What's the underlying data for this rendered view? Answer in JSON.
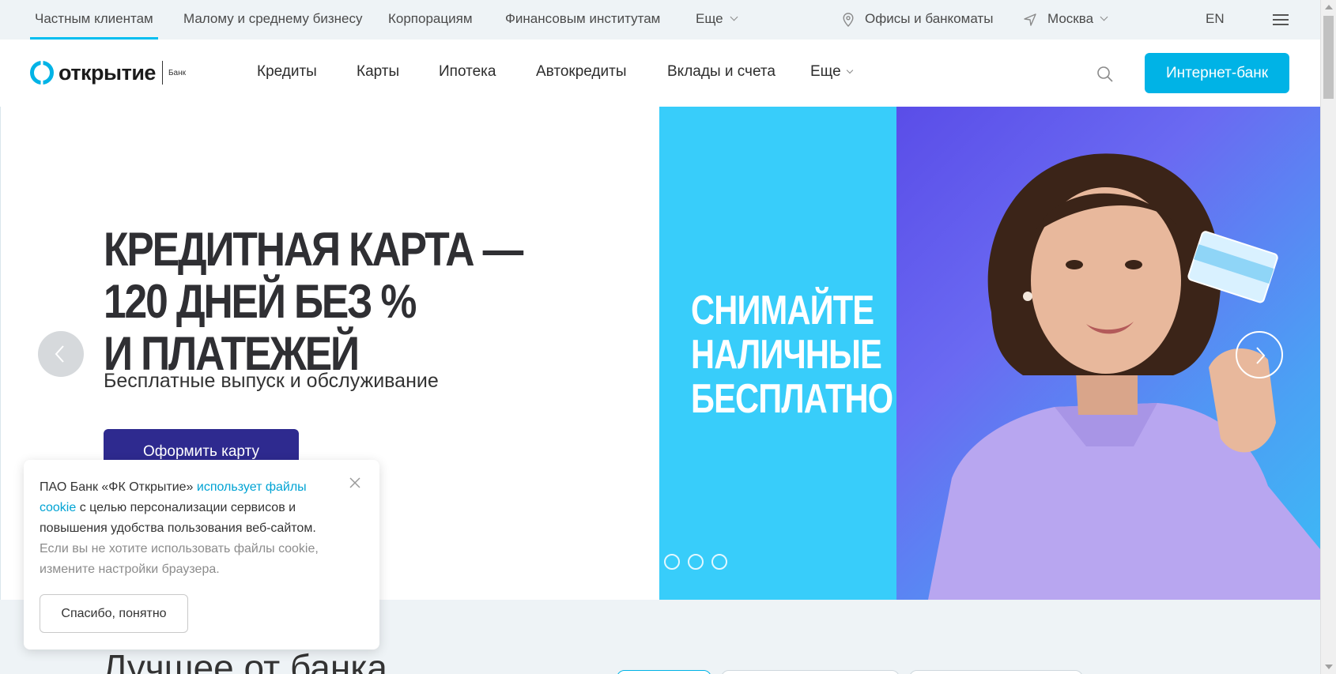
{
  "topbar": {
    "segments": [
      "Частным клиентам",
      "Малому и среднему бизнесу",
      "Корпорациям",
      "Финансовым институтам",
      "Еще"
    ],
    "offices": "Офисы и банкоматы",
    "city": "Москва",
    "lang": "EN"
  },
  "header": {
    "logo_text": "открытие",
    "logo_bank": "Банк",
    "nav": [
      "Кредиты",
      "Карты",
      "Ипотека",
      "Автокредиты",
      "Вклады и счета",
      "Еще"
    ],
    "internet_bank": "Интернет-банк"
  },
  "hero": {
    "title_lines": [
      "КРЕДИТНАЯ КАРТА —",
      "120 ДНЕЙ БЕЗ %",
      "И ПЛАТЕЖЕЙ"
    ],
    "subtitle": "Бесплатные выпуск и обслуживание",
    "cta": "Оформить карту",
    "promo_lines": [
      "СНИМАЙТЕ",
      "НАЛИЧНЫЕ",
      "БЕСПЛАТНО"
    ],
    "slides_count": 3
  },
  "section": {
    "title": "Лучшее от банка"
  },
  "cookie": {
    "text_1": "ПАО Банк «ФК Открытие» ",
    "link": "использует файлы cookie",
    "text_2": " с целью персонализации сервисов и повышения удобства пользования веб-сайтом.",
    "muted": "Если вы не хотите использовать файлы cookie, измените настройки браузера.",
    "button": "Спасибо, понятно"
  },
  "colors": {
    "accent": "#00b3e6",
    "cta": "#2e2a8f",
    "promo_bg": "#38cdfa"
  }
}
